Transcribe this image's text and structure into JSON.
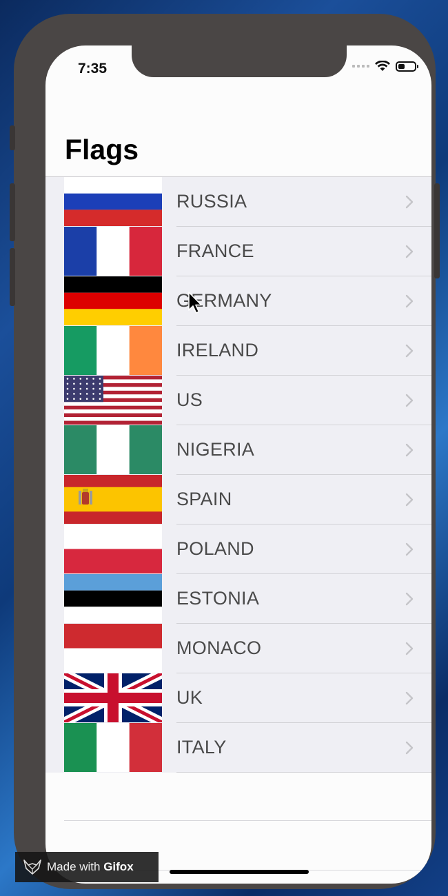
{
  "status_bar": {
    "time": "7:35"
  },
  "nav": {
    "title": "Flags"
  },
  "countries": [
    {
      "name": "RUSSIA",
      "flag": "russia"
    },
    {
      "name": "FRANCE",
      "flag": "france"
    },
    {
      "name": "GERMANY",
      "flag": "germany"
    },
    {
      "name": "IRELAND",
      "flag": "ireland"
    },
    {
      "name": "US",
      "flag": "us"
    },
    {
      "name": "NIGERIA",
      "flag": "nigeria"
    },
    {
      "name": "SPAIN",
      "flag": "spain"
    },
    {
      "name": "POLAND",
      "flag": "poland"
    },
    {
      "name": "ESTONIA",
      "flag": "estonia"
    },
    {
      "name": "MONACO",
      "flag": "monaco"
    },
    {
      "name": "UK",
      "flag": "uk"
    },
    {
      "name": "ITALY",
      "flag": "italy"
    }
  ],
  "icons": {
    "disclosure": "chevron-right-icon",
    "wifi": "wifi-icon",
    "battery": "battery-icon",
    "cursor": "pointer-cursor-icon",
    "gifox": "fox-logo-icon"
  },
  "watermark": {
    "prefix": "Made with ",
    "brand": "Gifox"
  },
  "colors": {
    "list_bg": "#efeff4",
    "label": "#4a4a4a",
    "separator": "#d2d2d6"
  }
}
